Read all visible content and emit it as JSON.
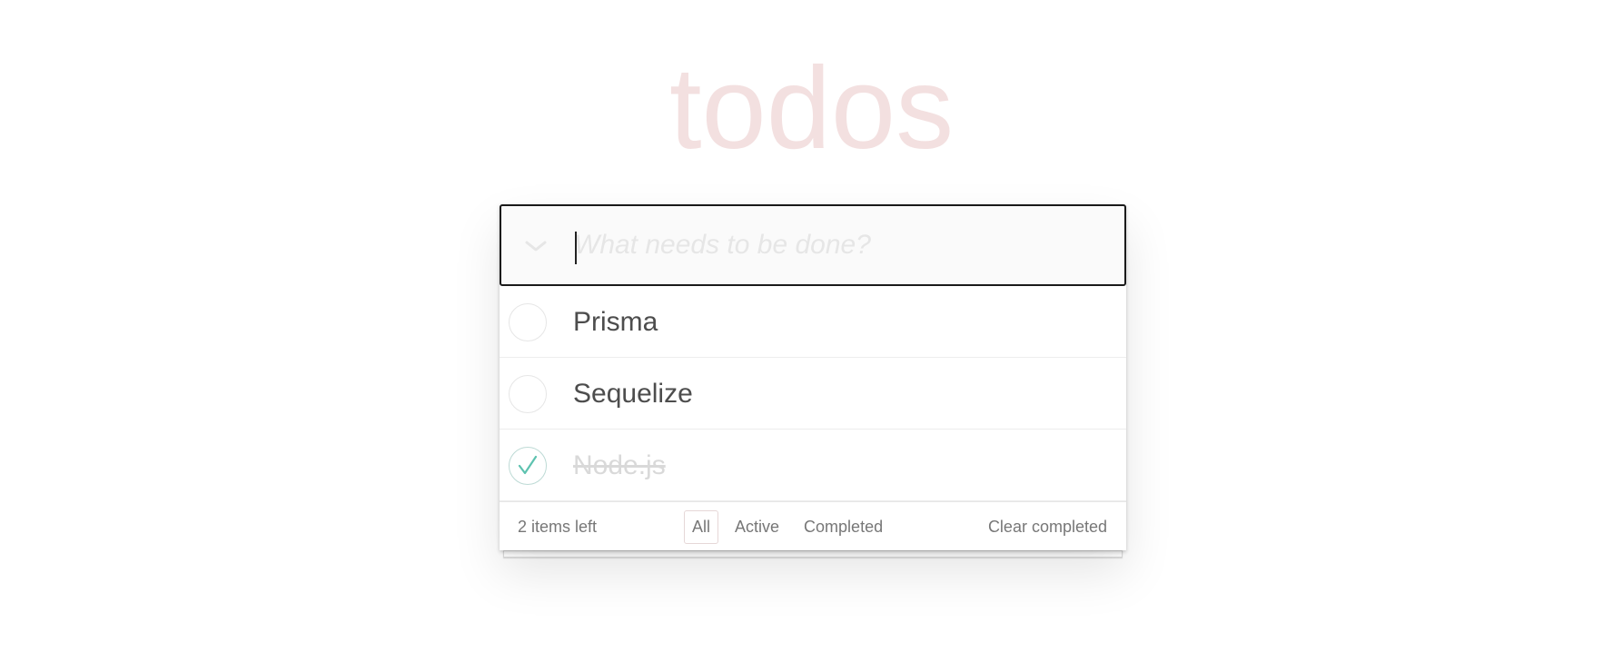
{
  "app": {
    "title": "todos"
  },
  "header": {
    "new_todo_placeholder": "What needs to be done?",
    "new_todo_value": "",
    "toggle_all_icon": "chevron-down-icon"
  },
  "todos": [
    {
      "label": "Prisma",
      "completed": false
    },
    {
      "label": "Sequelize",
      "completed": false
    },
    {
      "label": "Node.js",
      "completed": true
    }
  ],
  "footer": {
    "count_text": "2 items left",
    "filters": [
      {
        "label": "All",
        "selected": true
      },
      {
        "label": "Active",
        "selected": false
      },
      {
        "label": "Completed",
        "selected": false
      }
    ],
    "clear_completed_label": "Clear completed"
  },
  "colors": {
    "title": "#f0dfdf",
    "check_green": "#5dc2af",
    "text": "#4d4d4d",
    "completed_text": "#d9d9d9"
  }
}
